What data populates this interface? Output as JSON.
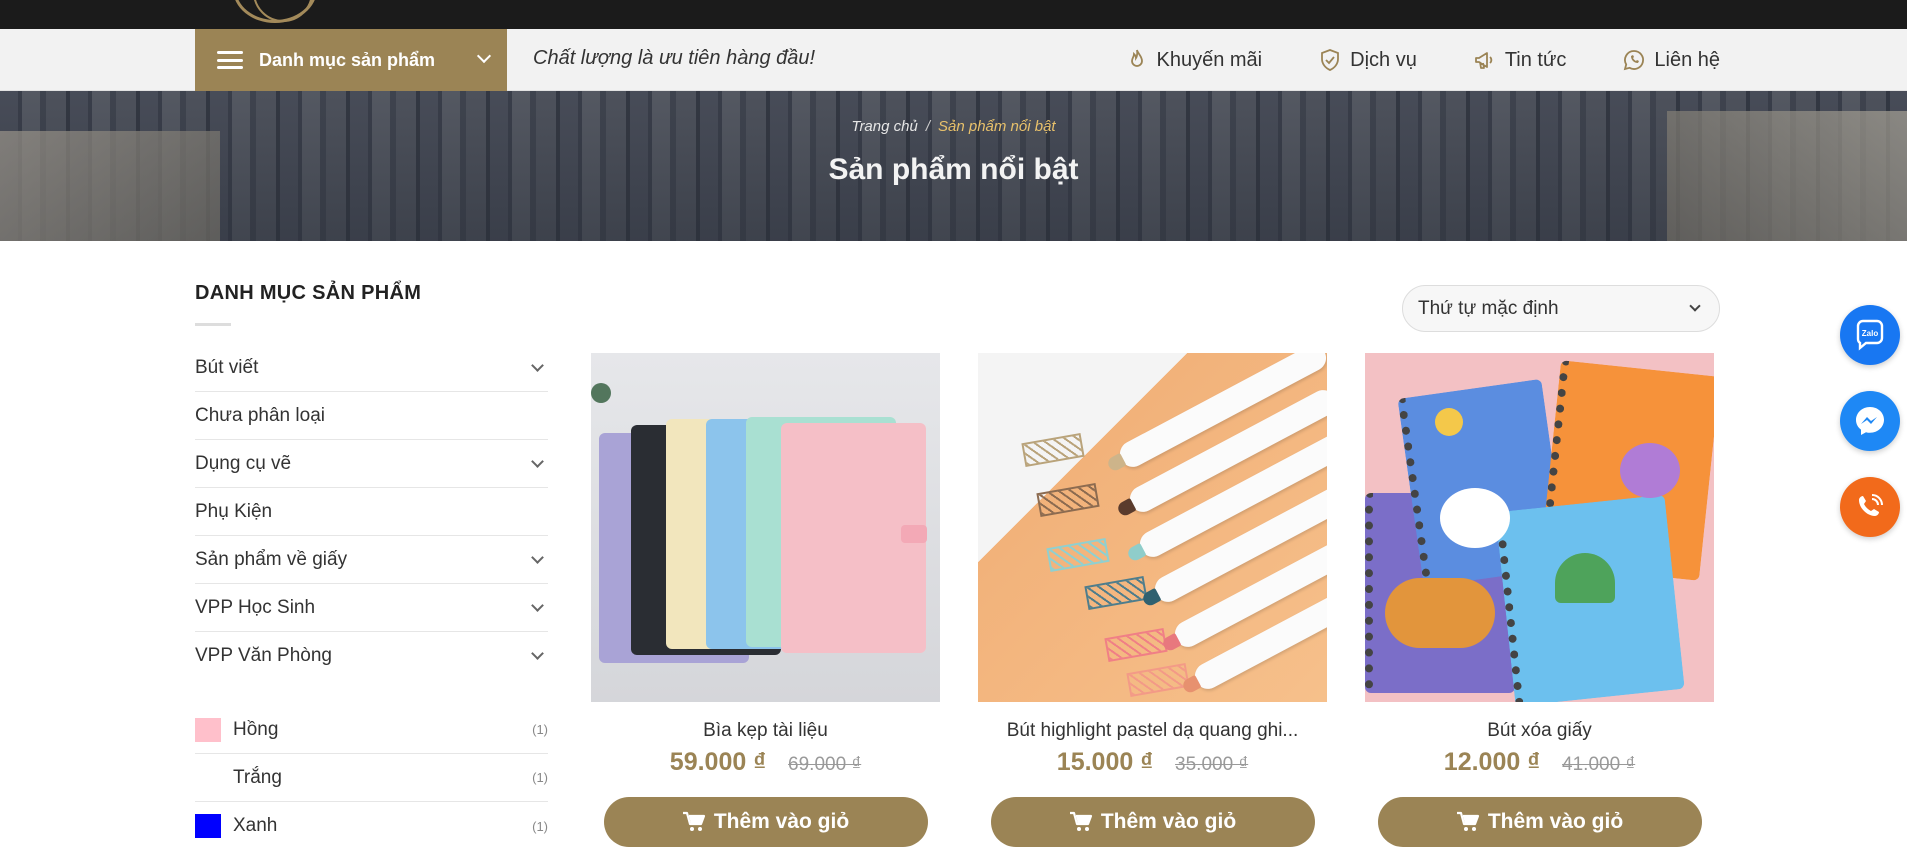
{
  "header": {
    "category_menu_label": "Danh mục sản phẩm",
    "tagline": "Chất lượng là ưu tiên hàng đầu!",
    "nav": [
      {
        "label": "Khuyến mãi",
        "icon": "fire-icon"
      },
      {
        "label": "Dịch vụ",
        "icon": "shield-icon"
      },
      {
        "label": "Tin tức",
        "icon": "megaphone-icon"
      },
      {
        "label": "Liên hệ",
        "icon": "whatsapp-icon"
      }
    ]
  },
  "banner": {
    "breadcrumb_home": "Trang chủ",
    "breadcrumb_separator": "/",
    "breadcrumb_current": "Sản phẩm nổi bật",
    "title": "Sản phẩm nổi bật"
  },
  "sidebar": {
    "title": "DANH MỤC SẢN PHẨM",
    "categories": [
      {
        "label": "Bút viết",
        "expandable": true
      },
      {
        "label": "Chưa phân loại",
        "expandable": false
      },
      {
        "label": "Dụng cụ vẽ",
        "expandable": true
      },
      {
        "label": "Phụ Kiện",
        "expandable": false
      },
      {
        "label": "Sản phẩm về giấy",
        "expandable": true
      },
      {
        "label": "VPP Học Sinh",
        "expandable": true
      },
      {
        "label": "VPP Văn Phòng",
        "expandable": true
      }
    ],
    "colors": [
      {
        "label": "Hồng",
        "count": "(1)",
        "swatch": "#ffc0cb"
      },
      {
        "label": "Trắng",
        "count": "(1)",
        "swatch": "#ffffff"
      },
      {
        "label": "Xanh",
        "count": "(1)",
        "swatch": "#0000ff"
      }
    ]
  },
  "sort": {
    "selected": "Thứ tự mặc định"
  },
  "products": [
    {
      "name": "Bìa kẹp tài liệu",
      "price": "59.000 ₫",
      "old_price": "69.000 ₫",
      "button": "Thêm vào giỏ"
    },
    {
      "name": "Bút highlight pastel dạ quang ghi...",
      "price": "15.000 ₫",
      "old_price": "35.000 ₫",
      "button": "Thêm vào giỏ"
    },
    {
      "name": "Bút xóa giấy",
      "price": "12.000 ₫",
      "old_price": "41.000 ₫",
      "button": "Thêm vào giỏ"
    }
  ],
  "floating": {
    "zalo_label": "Zalo"
  },
  "colors": {
    "accent": "#9b8455",
    "topbar": "#1b1b1b",
    "zalo": "#1877f2",
    "messenger": "#1e88f5",
    "phone": "#f26a1b"
  }
}
